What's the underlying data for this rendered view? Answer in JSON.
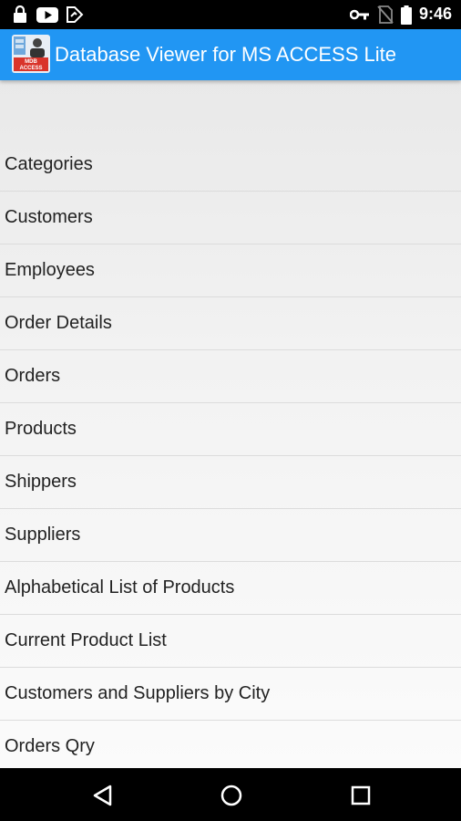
{
  "status_bar": {
    "time": "9:46",
    "left_icons": [
      "lock-icon",
      "youtube-icon",
      "notification-icon"
    ],
    "right_icons": [
      "vpn-key-icon",
      "no-sim-icon",
      "battery-icon"
    ]
  },
  "app_bar": {
    "title": "Database Viewer for MS ACCESS Lite",
    "logo_text": "MDB ACCESS",
    "color": "#2196f3"
  },
  "list": {
    "items": [
      "Categories",
      "Customers",
      "Employees",
      "Order Details",
      "Orders",
      "Products",
      "Shippers",
      "Suppliers",
      "Alphabetical List of Products",
      "Current Product List",
      "Customers and Suppliers by City",
      "Orders Qry"
    ]
  },
  "nav_bar": {
    "buttons": [
      "back-icon",
      "home-icon",
      "recents-icon"
    ]
  }
}
